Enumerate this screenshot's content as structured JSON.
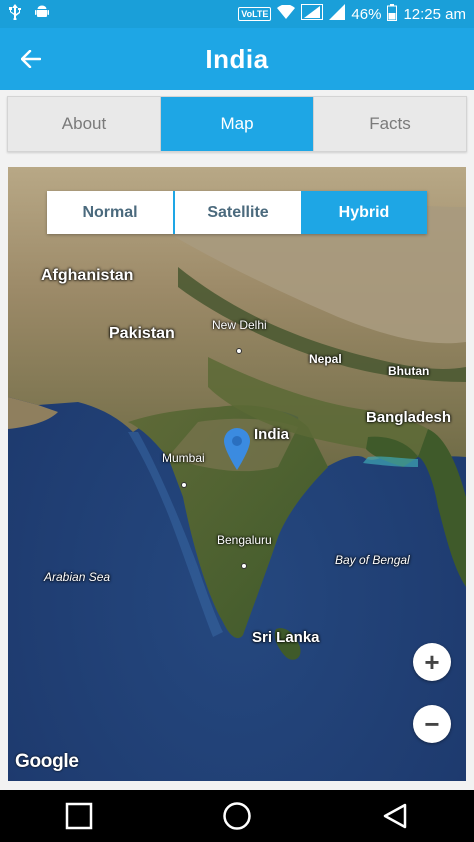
{
  "status_bar": {
    "volte": "VoLTE",
    "battery": "46%",
    "time": "12:25 am"
  },
  "app_bar": {
    "title": "India"
  },
  "tabs": [
    {
      "label": "About",
      "active": false
    },
    {
      "label": "Map",
      "active": true
    },
    {
      "label": "Facts",
      "active": false
    }
  ],
  "map": {
    "map_types": [
      {
        "label": "Normal",
        "active": false
      },
      {
        "label": "Satellite",
        "active": false
      },
      {
        "label": "Hybrid",
        "active": true
      }
    ],
    "labels": {
      "afghanistan": "Afghanistan",
      "pakistan": "Pakistan",
      "new_delhi": "New Delhi",
      "nepal": "Nepal",
      "bhutan": "Bhutan",
      "bangladesh": "Bangladesh",
      "india": "India",
      "mumbai": "Mumbai",
      "bengaluru": "Bengaluru",
      "bay_of_bengal": "Bay of Bengal",
      "arabian_sea": "Arabian Sea",
      "sri_lanka": "Sri Lanka"
    },
    "zoom_in": "+",
    "zoom_out": "−",
    "attribution": "Google",
    "colors": {
      "ocean": "#1f3f7a",
      "marker": "#3b8be0"
    }
  },
  "colors": {
    "accent": "#1ea6e5",
    "status_bar": "#1a9fd9"
  }
}
